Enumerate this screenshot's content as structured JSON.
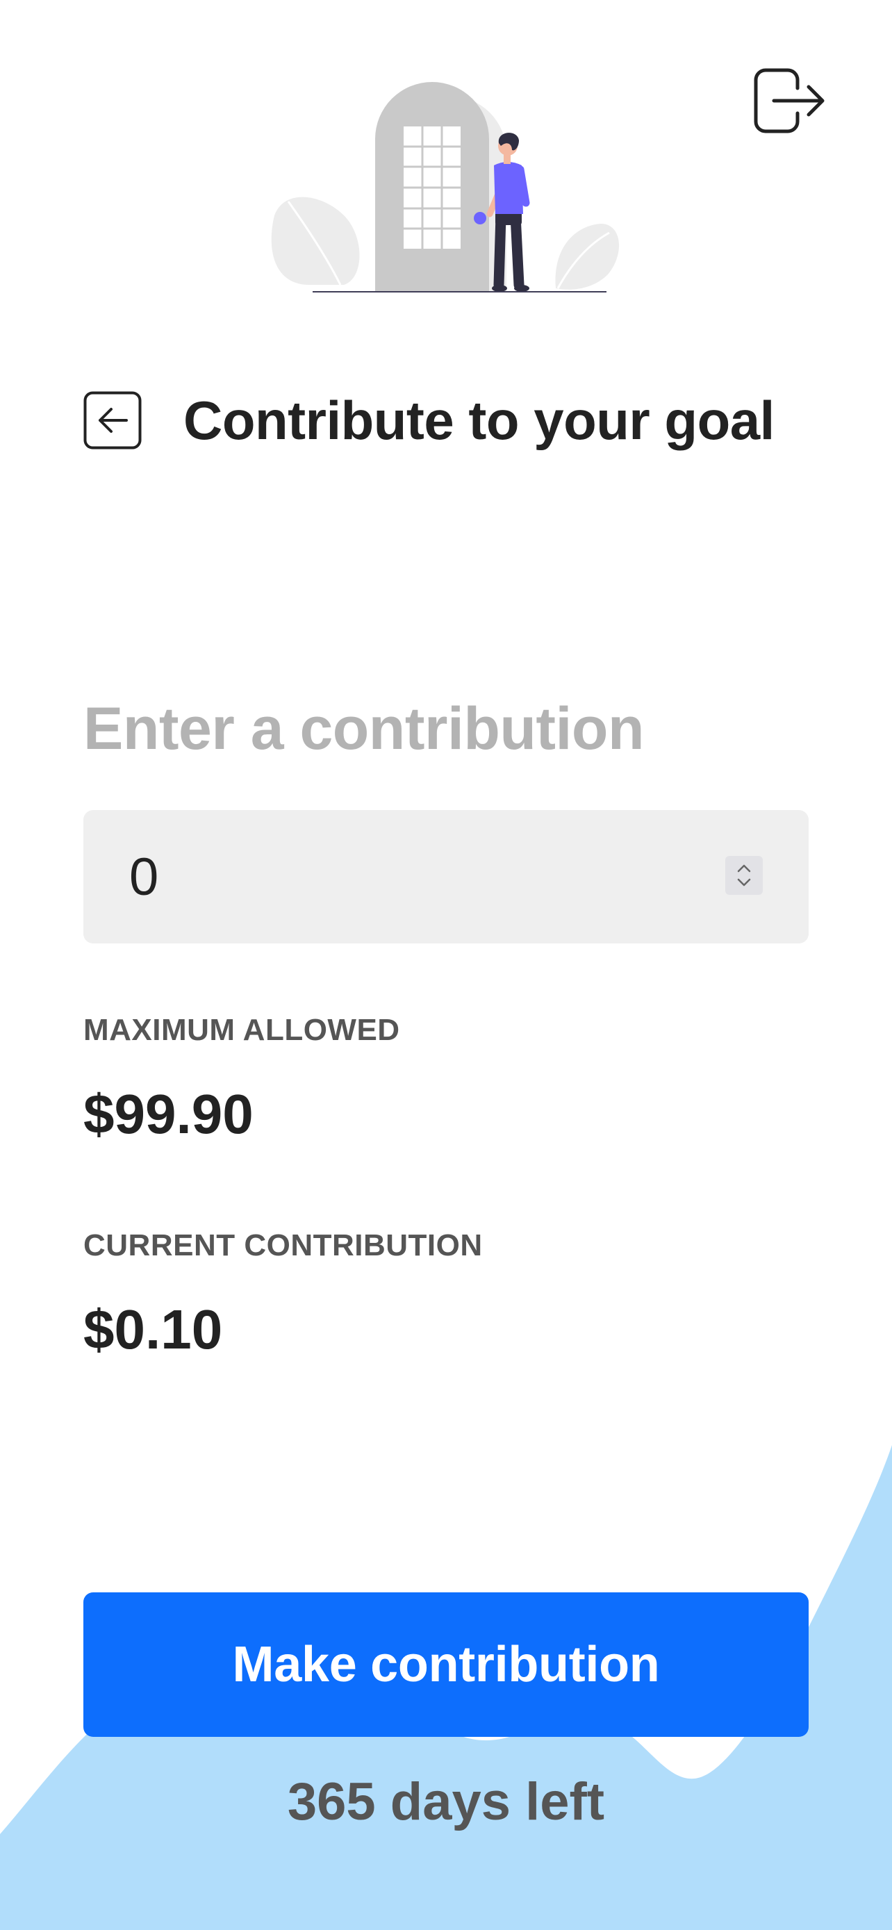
{
  "header": {
    "title": "Contribute to your goal",
    "back_icon": "arrow-left-square-icon",
    "logout_icon": "box-arrow-right-icon"
  },
  "hero": {
    "icon": "person-at-door-illustration",
    "accent_color": "#6c63ff"
  },
  "contribution": {
    "heading": "Enter a contribution",
    "input_value": "0"
  },
  "stats": {
    "max_label": "MAXIMUM ALLOWED",
    "max_value": "$99.90",
    "current_label": "CURRENT CONTRIBUTION",
    "current_value": "$0.10"
  },
  "actions": {
    "make_contribution_label": "Make contribution"
  },
  "footer": {
    "days_left": "365 days left"
  },
  "colors": {
    "primary": "#0d6efd",
    "wave": "#b1ddfb",
    "muted_heading": "#b3b3b3",
    "field_bg": "#efefef"
  }
}
